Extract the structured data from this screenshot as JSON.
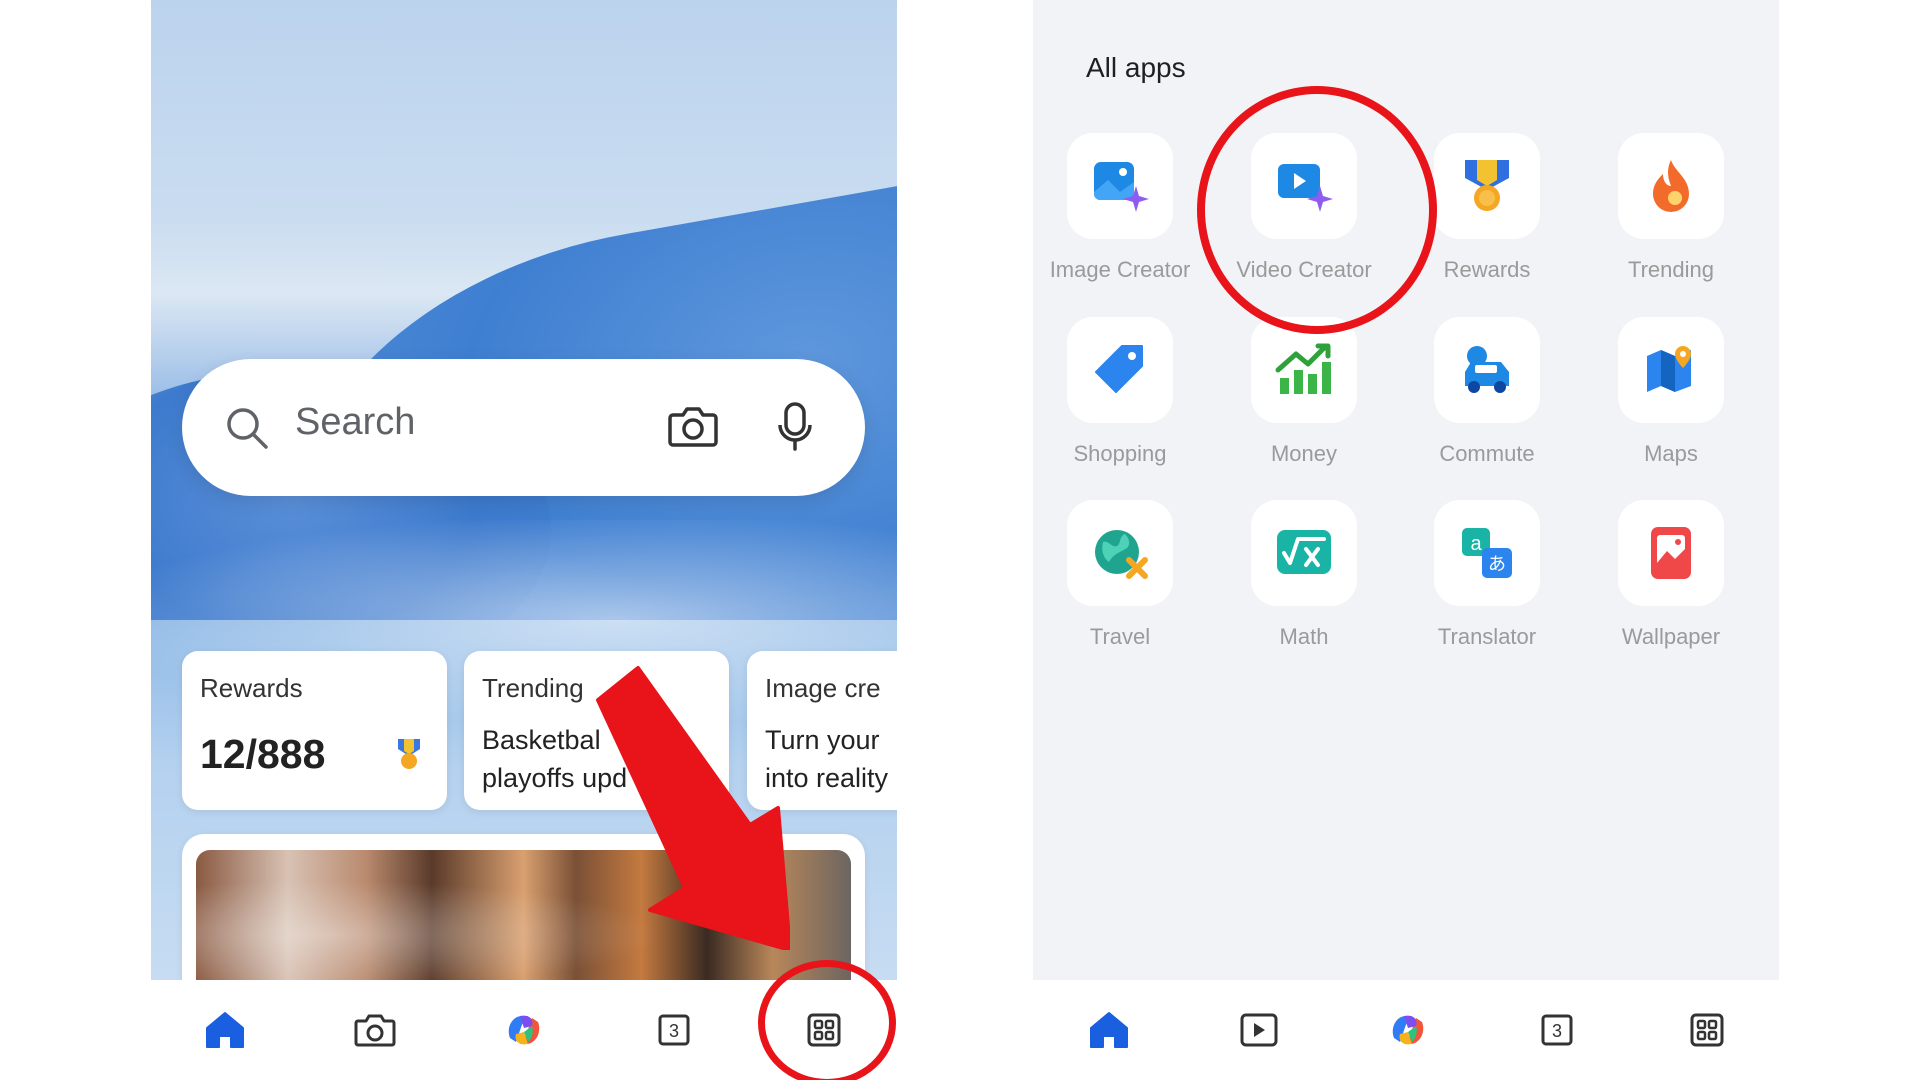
{
  "left_screen": {
    "search": {
      "placeholder": "Search"
    },
    "cards": {
      "rewards": {
        "title": "Rewards",
        "points": "12/888"
      },
      "trending": {
        "title": "Trending",
        "line1": "Basketbal",
        "line2": "playoffs upd"
      },
      "image_creator": {
        "title": "Image cre",
        "line1": "Turn your",
        "line2": "into reality"
      }
    },
    "bottom_nav": {
      "items": [
        "home-icon",
        "camera-icon",
        "copilot-icon",
        "tabs-icon",
        "apps-grid-icon"
      ],
      "tab_count": "3",
      "active_color": "#1a5fe0"
    }
  },
  "right_screen": {
    "section_title": "All apps",
    "apps": [
      {
        "label": "Image Creator",
        "icon": "image-creator-icon"
      },
      {
        "label": "Video Creator",
        "icon": "video-creator-icon"
      },
      {
        "label": "Rewards",
        "icon": "rewards-icon"
      },
      {
        "label": "Trending",
        "icon": "trending-icon"
      },
      {
        "label": "Shopping",
        "icon": "shopping-icon"
      },
      {
        "label": "Money",
        "icon": "money-icon"
      },
      {
        "label": "Commute",
        "icon": "commute-icon"
      },
      {
        "label": "Maps",
        "icon": "maps-icon"
      },
      {
        "label": "Travel",
        "icon": "travel-icon"
      },
      {
        "label": "Math",
        "icon": "math-icon"
      },
      {
        "label": "Translator",
        "icon": "translator-icon"
      },
      {
        "label": "Wallpaper",
        "icon": "wallpaper-icon"
      }
    ],
    "bottom_nav": {
      "items": [
        "home-icon",
        "video-icon",
        "copilot-icon",
        "tabs-icon",
        "apps-grid-icon"
      ],
      "tab_count": "3"
    }
  },
  "annotations": {
    "highlight_color": "#e8141a"
  }
}
